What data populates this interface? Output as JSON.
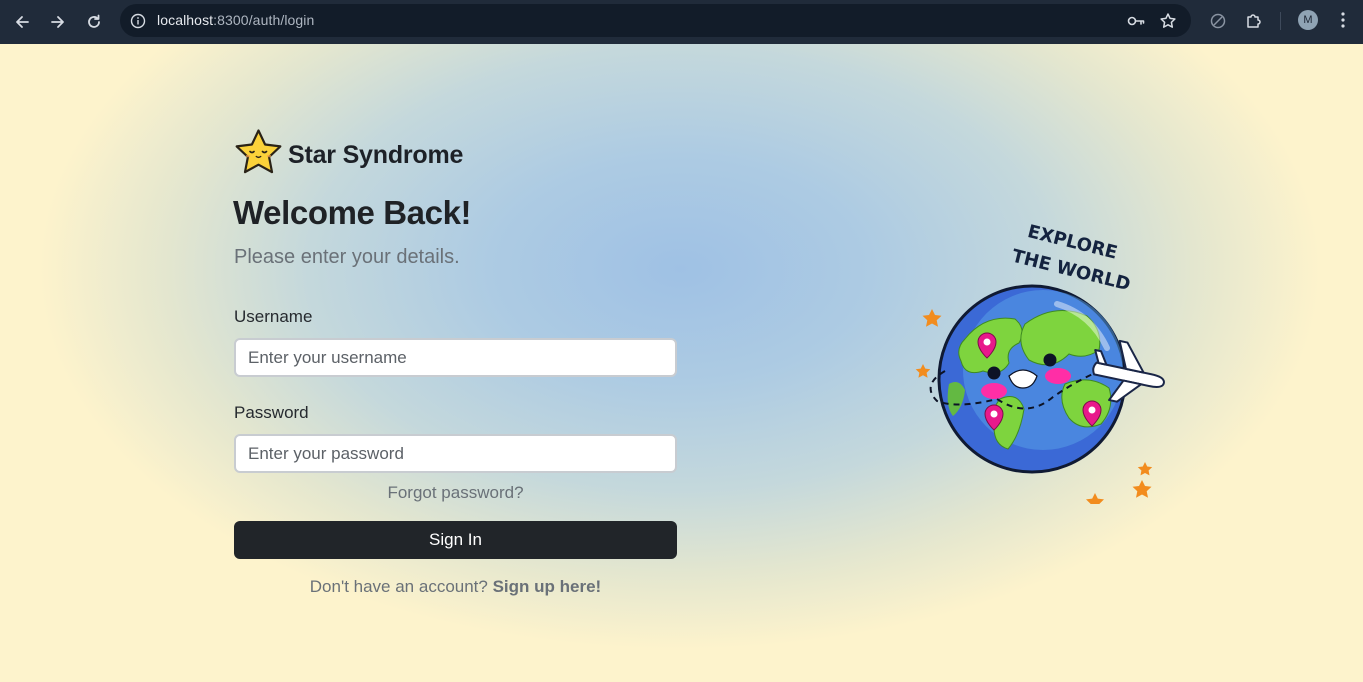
{
  "browser": {
    "url_host": "localhost",
    "url_rest": ":8300/auth/login",
    "profile_initial": "M",
    "icons": [
      "back-icon",
      "forward-icon",
      "reload-icon",
      "site-info-icon",
      "password-key-icon",
      "bookmark-star-icon",
      "performance-icon",
      "extensions-icon",
      "menu-icon"
    ]
  },
  "brand": {
    "name": "Star Syndrome",
    "logo_icon": "smiling-star-icon"
  },
  "login": {
    "title": "Welcome Back!",
    "subtitle": "Please enter your details.",
    "username_label": "Username",
    "username_placeholder": "Enter your username",
    "username_value": "",
    "password_label": "Password",
    "password_placeholder": "Enter your password",
    "password_value": "",
    "forgot_label": "Forgot password?",
    "submit_label": "Sign In",
    "signup_prompt": "Don't have an account?",
    "signup_link": "Sign up here!"
  },
  "illustration": {
    "caption_line1": "EXPLORE",
    "caption_line2": "THE WORLD",
    "icon": "globe-with-airplane-illustration"
  },
  "colors": {
    "chrome_bg": "#202b3a",
    "button_bg": "#212529",
    "accent_star": "#f28c1e",
    "pin": "#e8198b"
  }
}
